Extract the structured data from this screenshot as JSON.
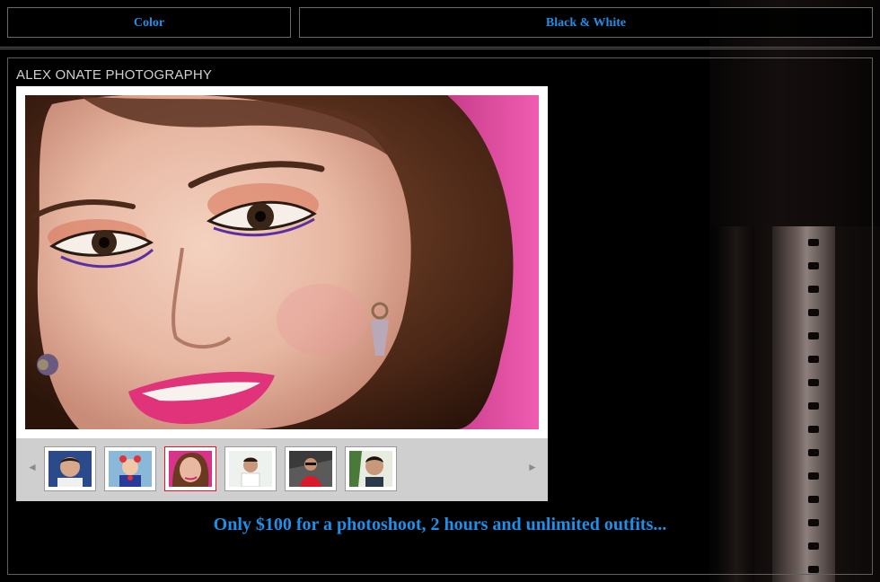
{
  "nav": {
    "items": [
      {
        "label": "Color"
      },
      {
        "label": "Black & White"
      }
    ]
  },
  "site": {
    "title": "ALEX ONATE PHOTOGRAPHY"
  },
  "gallery": {
    "prev_icon": "◄",
    "next_icon": "►",
    "selected_index": 2,
    "thumbnails_count": 6
  },
  "promo": {
    "text": "Only $100 for a photoshoot, 2 hours and unlimited outfits..."
  },
  "colors": {
    "accent": "#1f8fe8",
    "active_thumb_border": "#d21a2a",
    "background": "#000000"
  }
}
